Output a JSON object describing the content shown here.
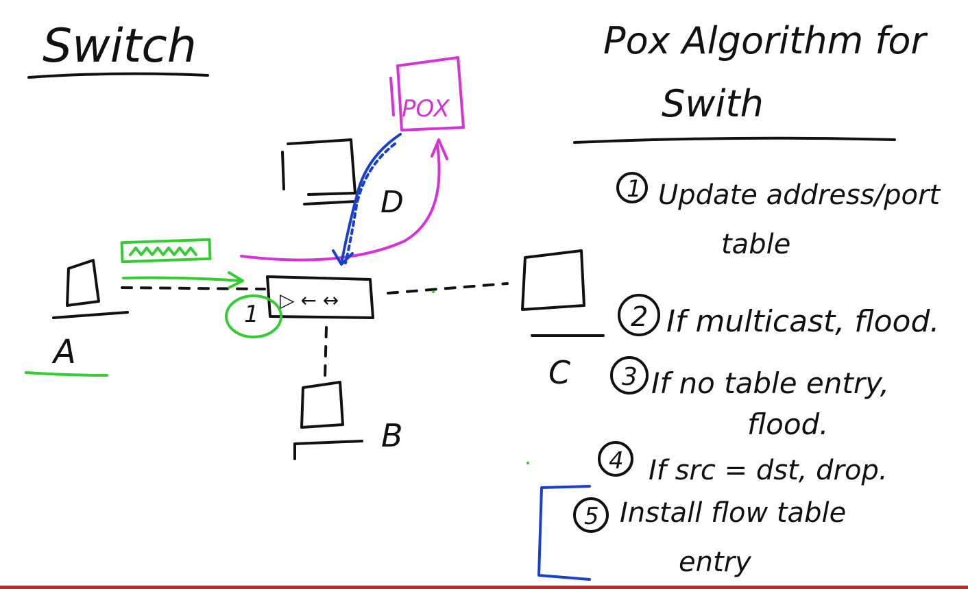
{
  "diagram": {
    "title": "Switch",
    "algorithm_title_line1": "Pox Algorithm for",
    "algorithm_title_line2": "Swith",
    "controller_label": "POX",
    "hosts": {
      "a": "A",
      "b": "B",
      "c": "C",
      "d": "D"
    },
    "port_label": "1",
    "steps": [
      {
        "num": "1",
        "line1": "Update address/port",
        "line2": "table"
      },
      {
        "num": "2",
        "line1": "If multicast, flood.",
        "line2": ""
      },
      {
        "num": "3",
        "line1": "If no table entry,",
        "line2": "flood."
      },
      {
        "num": "4",
        "line1": "If src = dst, drop.",
        "line2": ""
      },
      {
        "num": "5",
        "line1": "Install flow table",
        "line2": "entry"
      }
    ]
  },
  "colors": {
    "ink": "#111111",
    "green": "#33cc33",
    "magenta": "#d633d6",
    "blue": "#1a3fcc",
    "bottom_bar": "#cc2222"
  }
}
